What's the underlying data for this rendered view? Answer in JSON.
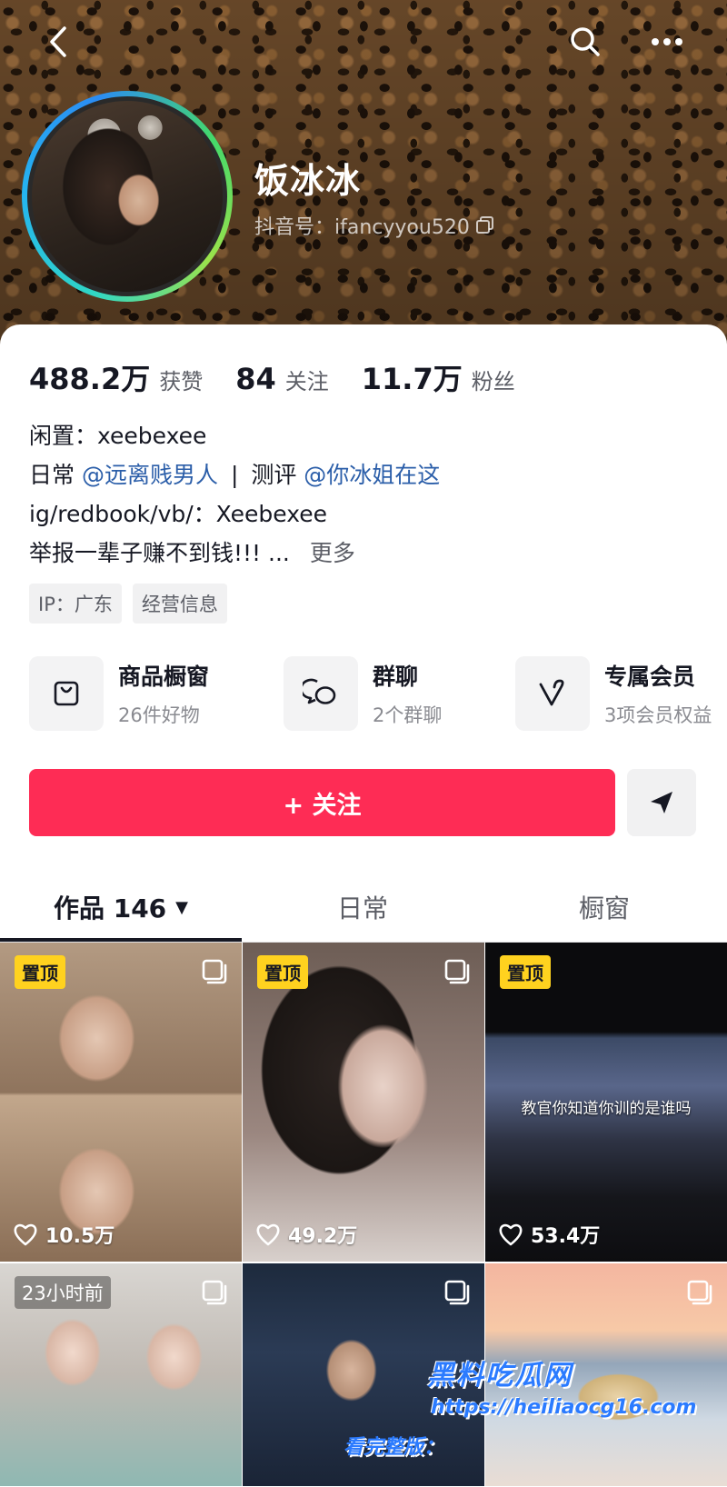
{
  "header": {
    "back_icon": "chevron-left-icon",
    "search_icon": "search-icon",
    "more_icon": "more-icon"
  },
  "profile": {
    "nickname": "饭冰冰",
    "douyin_id": "抖音号：ifancyyou520",
    "avatar_ring_colors": [
      "#2fd6c6",
      "#25b4f0",
      "#44d96b"
    ]
  },
  "stats": [
    {
      "value": "488.2万",
      "label": "获赞"
    },
    {
      "value": "84",
      "label": "关注"
    },
    {
      "value": "11.7万",
      "label": "粉丝"
    }
  ],
  "bio": {
    "line1": "闲置：xeebexee",
    "line2_prefix": "日常",
    "line2_mention1": "@远离贱男人",
    "line2_sep": "|",
    "line2_mid": "测评",
    "line2_mention2": "@你冰姐在这",
    "line3": "ig/redbook/vb/：Xeebexee",
    "line4": "举报一辈子赚不到钱!!! ...",
    "more": "更多"
  },
  "tags": [
    "IP：广东",
    "经营信息"
  ],
  "quick_links": [
    {
      "title": "商品橱窗",
      "sub": "26件好物",
      "icon": "shopping-bag-icon"
    },
    {
      "title": "群聊",
      "sub": "2个群聊",
      "icon": "chat-bubbles-icon"
    },
    {
      "title": "专属会员",
      "sub": "3项会员权益",
      "icon": "heart-v-icon"
    }
  ],
  "actions": {
    "follow_label": "+ 关注",
    "share_icon": "send-icon"
  },
  "tabs": [
    {
      "label": "作品 146",
      "active": true
    },
    {
      "label": "日常",
      "active": false
    },
    {
      "label": "橱窗",
      "active": false
    }
  ],
  "videos": [
    {
      "badge": "置顶",
      "likes": "10.5万",
      "multi": true
    },
    {
      "badge": "置顶",
      "likes": "49.2万",
      "multi": true
    },
    {
      "badge": "置顶",
      "likes": "53.4万",
      "caption": "教官你知道你训的是谁吗",
      "multi": false
    },
    {
      "badge": "23小时前",
      "multi": true
    },
    {
      "multi": true
    },
    {
      "multi": true
    }
  ],
  "watermark": {
    "title": "黑料吃瓜网",
    "url": "https://heiliaocg16.com",
    "prefix": "看完整版："
  },
  "colors": {
    "accent": "#fe2c55",
    "mention": "#2b5ea9",
    "pin_badge": "#ffd21f"
  }
}
